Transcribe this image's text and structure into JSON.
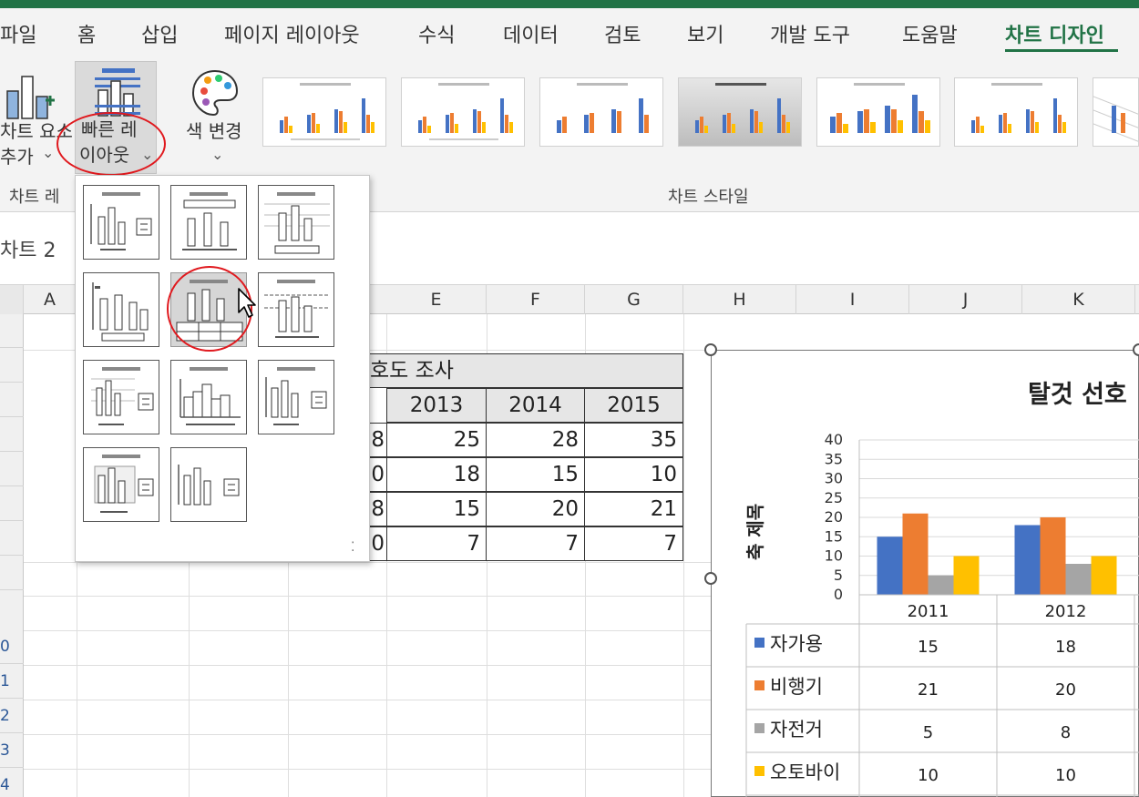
{
  "ribbon_tabs": [
    "파일",
    "홈",
    "삽입",
    "페이지 레이아웃",
    "수식",
    "데이터",
    "검토",
    "보기",
    "개발 도구",
    "도움말",
    "차트 디자인"
  ],
  "ribbon": {
    "add_element_line1": "차트 요소",
    "add_element_line2": "추가",
    "quick_layout_line1": "빠른 레",
    "quick_layout_line2": "이아웃",
    "change_color_label": "색 변경",
    "chart_layouts_group": "차트 레",
    "chart_styles_group": "차트 스타일",
    "accent_color": "#217346",
    "highlight_color": "#e0191e"
  },
  "name_box": "차트 2",
  "columns": [
    "A",
    "E",
    "F",
    "G",
    "H",
    "I",
    "J",
    "K"
  ],
  "rows": [
    "",
    "",
    "",
    "",
    "",
    "",
    "",
    "",
    "0",
    "1",
    "2",
    "3",
    "4"
  ],
  "data_table": {
    "title": "호도 조사",
    "headers": [
      "2013",
      "2014",
      "2015"
    ],
    "rows": [
      [
        "8",
        "25",
        "28",
        "35"
      ],
      [
        "0",
        "18",
        "15",
        "10"
      ],
      [
        "8",
        "15",
        "20",
        "21"
      ],
      [
        "0",
        "7",
        "7",
        "7"
      ]
    ]
  },
  "quick_layout": {
    "item_count": 11,
    "hovered_index": 4,
    "resize_grip": "⁚"
  },
  "chart_data": {
    "type": "bar",
    "title": "탈것 선호",
    "ylabel": "축 제목",
    "ylim": [
      0,
      40
    ],
    "yticks": [
      "40",
      "35",
      "30",
      "25",
      "20",
      "15",
      "10",
      "5",
      "0"
    ],
    "categories": [
      "2011",
      "2012"
    ],
    "series": [
      {
        "name": "자가용",
        "values": [
          15,
          18
        ],
        "color": "#4472c4"
      },
      {
        "name": "비행기",
        "values": [
          21,
          20
        ],
        "color": "#ed7d31"
      },
      {
        "name": "자전거",
        "values": [
          5,
          8
        ],
        "color": "#a5a5a5"
      },
      {
        "name": "오토바이",
        "values": [
          10,
          10
        ],
        "color": "#ffc000"
      }
    ],
    "data_table_values": [
      [
        "15",
        "18"
      ],
      [
        "21",
        "20"
      ],
      [
        "5",
        "8"
      ],
      [
        "10",
        "10"
      ]
    ]
  }
}
